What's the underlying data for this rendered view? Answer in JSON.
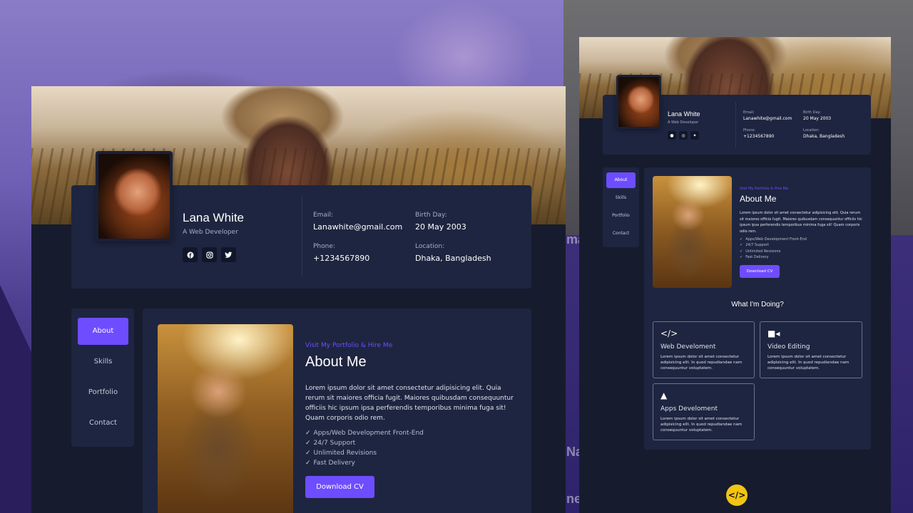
{
  "profile": {
    "name": "Lana White",
    "role": "A Web Developer",
    "email_label": "Email:",
    "email": "Lanawhite@gmail.com",
    "birthday_label": "Birth Day:",
    "birthday": "20 May 2003",
    "phone_label": "Phone:",
    "phone": "+1234567890",
    "location_label": "Location:",
    "location": "Dhaka, Bangladesh",
    "socials": [
      "facebook-icon",
      "instagram-icon",
      "twitter-icon"
    ]
  },
  "nav": {
    "items": [
      "About",
      "Skills",
      "Portfolio",
      "Contact"
    ],
    "active": "About"
  },
  "about": {
    "eyebrow": "Visit My Portfolio & Hire Me",
    "title": "About Me",
    "paragraph": "Lorem ipsum dolor sit amet consectetur adipisicing elit. Quia rerum sit maiores officia fugit. Maiores quibusdam consequuntur officiis hic ipsum ipsa perferendis temporibus minima fuga sit! Quam corporis odio rem.",
    "bullets": [
      "Apps/Web Development Front-End",
      "24/7 Support",
      "Unlimited Revisions",
      "Fast Delivery"
    ],
    "bullets_side": [
      "Apps/Web Development Front-End",
      "24/7 Support",
      "Unlimited Revisions",
      "Fast Delivery"
    ],
    "button": "Download CV"
  },
  "services": {
    "title": "What I'm Doing?",
    "items": [
      {
        "icon": "code-icon",
        "title": "Web Develoment",
        "desc": "Lorem ipsum dolor sit amet consectetur adipisicing elit. In quod repudiandae nam consequuntur voluptatem."
      },
      {
        "icon": "video-icon",
        "title": "Video Editing",
        "desc": "Lorem ipsum dolor sit amet consectetur adipisicing elit. In quod repudiandae nam consequuntur voluptatem."
      },
      {
        "icon": "android-icon",
        "title": "Apps Develoment",
        "desc": "Lorem ipsum dolor sit amet consectetur adipisicing elit. In quod repudiandae nam consequuntur voluptatem."
      }
    ]
  },
  "background_fragments": [
    "mai",
    "Na",
    "ne"
  ],
  "colors": {
    "accent": "#6d4dff",
    "panel": "#1e2540",
    "page_bg": "#161c2e",
    "logo_yellow": "#f2c413"
  }
}
